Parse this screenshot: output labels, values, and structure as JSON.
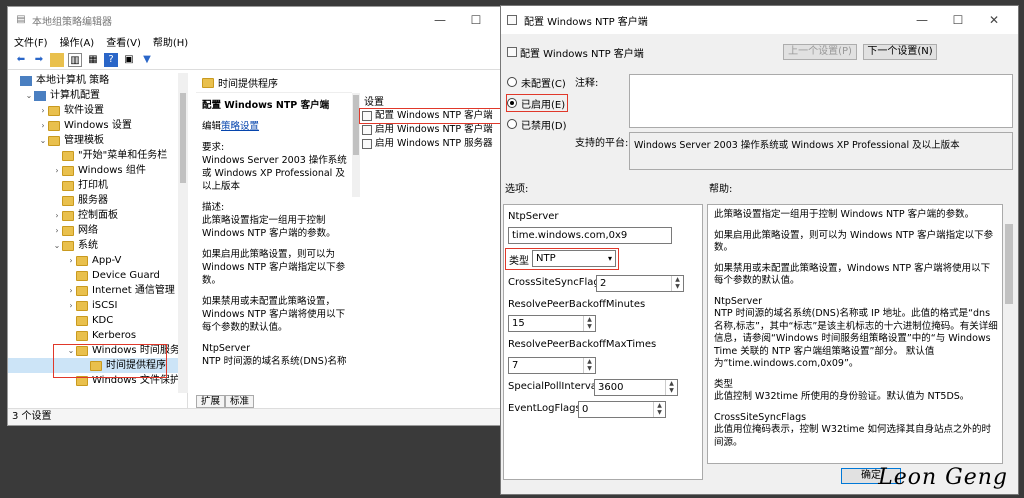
{
  "gpe": {
    "title": "本地组策略编辑器",
    "menu": [
      "文件(F)",
      "操作(A)",
      "查看(V)",
      "帮助(H)"
    ],
    "tree": [
      {
        "label": "本地计算机 策略",
        "level": 0,
        "exp": "",
        "icon": "pc"
      },
      {
        "label": "计算机配置",
        "level": 1,
        "exp": "v",
        "icon": "pc"
      },
      {
        "label": "软件设置",
        "level": 2,
        "exp": ">",
        "icon": "folder"
      },
      {
        "label": "Windows 设置",
        "level": 2,
        "exp": ">",
        "icon": "folder"
      },
      {
        "label": "管理模板",
        "level": 2,
        "exp": "v",
        "icon": "folder"
      },
      {
        "label": "\"开始\"菜单和任务栏",
        "level": 3,
        "exp": "",
        "icon": "folder"
      },
      {
        "label": "Windows 组件",
        "level": 3,
        "exp": ">",
        "icon": "folder"
      },
      {
        "label": "打印机",
        "level": 3,
        "exp": "",
        "icon": "folder"
      },
      {
        "label": "服务器",
        "level": 3,
        "exp": "",
        "icon": "folder"
      },
      {
        "label": "控制面板",
        "level": 3,
        "exp": ">",
        "icon": "folder"
      },
      {
        "label": "网络",
        "level": 3,
        "exp": ">",
        "icon": "folder"
      },
      {
        "label": "系统",
        "level": 3,
        "exp": "v",
        "icon": "folder"
      },
      {
        "label": "App-V",
        "level": 4,
        "exp": ">",
        "icon": "folder"
      },
      {
        "label": "Device Guard",
        "level": 4,
        "exp": "",
        "icon": "folder"
      },
      {
        "label": "Internet 通信管理",
        "level": 4,
        "exp": ">",
        "icon": "folder"
      },
      {
        "label": "iSCSI",
        "level": 4,
        "exp": ">",
        "icon": "folder"
      },
      {
        "label": "KDC",
        "level": 4,
        "exp": "",
        "icon": "folder"
      },
      {
        "label": "Kerberos",
        "level": 4,
        "exp": "",
        "icon": "folder"
      },
      {
        "label": "Windows 时间服务",
        "level": 4,
        "exp": "v",
        "icon": "folder"
      },
      {
        "label": "时间提供程序",
        "level": 5,
        "exp": "",
        "icon": "folder"
      },
      {
        "label": "Windows 文件保护",
        "level": 4,
        "exp": "",
        "icon": "folder"
      }
    ],
    "desc_header": "时间提供程序",
    "desc_title": "配置 Windows NTP 客户端",
    "desc_edit_prefix": "编辑",
    "desc_edit_link": "策略设置",
    "desc_paragraphs": [
      "要求:\nWindows Server 2003 操作系统或 Windows XP Professional 及以上版本",
      "描述:\n此策略设置指定一组用于控制 Windows NTP 客户端的参数。",
      "如果启用此策略设置，则可以为 Windows NTP 客户端指定以下参数。",
      "如果禁用或未配置此策略设置，Windows NTP 客户端将使用以下每个参数的默认值。",
      "NtpServer\nNTP 时间源的域名系统(DNS)名称"
    ],
    "list_header": "设置",
    "list_items": [
      "配置 Windows NTP 客户端",
      "启用 Windows NTP 客户端",
      "启用 Windows NTP 服务器"
    ],
    "tabs": [
      "扩展",
      "标准"
    ],
    "status": "3 个设置"
  },
  "dialog": {
    "title": "配置 Windows NTP 客户端",
    "heading": "配置 Windows NTP 客户端",
    "prev_btn": "上一个设置(P)",
    "next_btn": "下一个设置(N)",
    "radios": [
      "未配置(C)",
      "已启用(E)",
      "已禁用(D)"
    ],
    "selected_radio": 1,
    "comment_label": "注释:",
    "platform_label": "支持的平台:",
    "platform_value": "Windows Server 2003 操作系统或 Windows XP Professional 及以上版本",
    "options_label": "选项:",
    "help_label": "帮助:",
    "options": {
      "ntpserver_label": "NtpServer",
      "ntpserver_value": "time.windows.com,0x9",
      "type_label": "类型",
      "type_value": "NTP",
      "cross_label": "CrossSiteSyncFlags",
      "cross_value": "2",
      "peer_min_label": "ResolvePeerBackoffMinutes",
      "peer_min_value": "15",
      "peer_max_label": "ResolvePeerBackoffMaxTimes",
      "peer_max_value": "7",
      "poll_label": "SpecialPollInterval",
      "poll_value": "3600",
      "event_label": "EventLogFlags",
      "event_value": "0"
    },
    "help_paragraphs": [
      "此策略设置指定一组用于控制 Windows NTP 客户端的参数。",
      "如果启用此策略设置，则可以为 Windows NTP 客户端指定以下参数。",
      "如果禁用或未配置此策略设置，Windows NTP 客户端将使用以下每个参数的默认值。",
      "NtpServer\nNTP 时间源的域名系统(DNS)名称或 IP 地址。此值的格式是“dns 名称,标志”，其中“标志”是该主机标志的十六进制位掩码。有关详细信息，请参阅“Windows 时间服务组策略设置”中的“与 Windows Time 关联的 NTP 客户端组策略设置”部分。 默认值为“time.windows.com,0x09”。",
      "类型\n此值控制 W32time 所使用的身份验证。默认值为 NT5DS。",
      "CrossSiteSyncFlags\n此值用位掩码表示，控制 W32time 如何选择其自身站点之外的时间源。"
    ],
    "ok_btn": "确定"
  },
  "watermark": "Leon Geng"
}
